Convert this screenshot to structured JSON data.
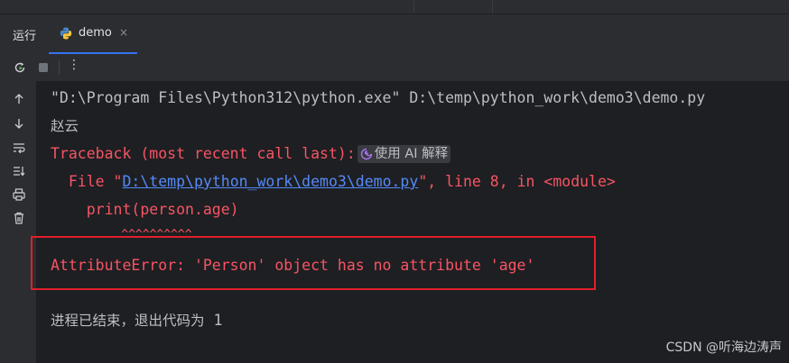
{
  "tool_window": {
    "title": "运行",
    "tab": {
      "label": "demo",
      "close": "×"
    }
  },
  "toolbar": {
    "rerun_icon": "rerun-icon",
    "stop_icon": "stop-icon",
    "more": "⋮"
  },
  "gutter_icons": [
    "arrow-up-icon",
    "arrow-down-icon",
    "soft-wrap-icon",
    "scroll-to-end-icon",
    "print-icon",
    "trash-icon"
  ],
  "console": {
    "command": "\"D:\\Program Files\\Python312\\python.exe\" D:\\temp\\python_work\\demo3\\demo.py",
    "output_line": "赵云",
    "traceback_header": "Traceback (most recent call last):",
    "ai_chip": "使用 AI 解释",
    "file_prefix": "  File \"",
    "file_link": "D:\\temp\\python_work\\demo3\\demo.py",
    "file_suffix": "\", line 8, in <module>",
    "code_line": "    print(person.age)",
    "caret_line": "          ^^^^^^^^^^",
    "error_line": "AttributeError: 'Person' object has no attribute 'age'",
    "exit_text": "进程已结束，退出代码为",
    "exit_code": " 1"
  },
  "colors": {
    "error_text": "#f75464",
    "link": "#548af7",
    "highlight_box": "#e0202a",
    "tab_underline": "#3574f0"
  },
  "watermark": "CSDN @听海边涛声"
}
